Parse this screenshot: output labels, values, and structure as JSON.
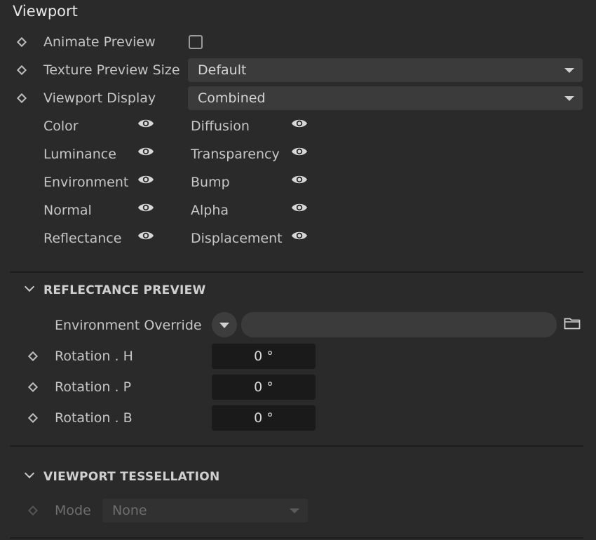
{
  "panel": {
    "title": "Viewport",
    "animate_preview": {
      "label": "Animate Preview",
      "checked": false
    },
    "texture_preview_size": {
      "label": "Texture Preview Size",
      "value": "Default"
    },
    "viewport_display": {
      "label": "Viewport Display",
      "value": "Combined"
    },
    "channels_left": [
      {
        "label": "Color",
        "icon": "eye-icon"
      },
      {
        "label": "Luminance",
        "icon": "eye-icon"
      },
      {
        "label": "Environment",
        "icon": "eye-icon"
      },
      {
        "label": "Normal",
        "icon": "eye-icon"
      },
      {
        "label": "Reflectance",
        "icon": "eye-icon"
      }
    ],
    "channels_right": [
      {
        "label": "Diffusion",
        "icon": "eye-icon"
      },
      {
        "label": "Transparency",
        "icon": "eye-icon"
      },
      {
        "label": "Bump",
        "icon": "eye-icon"
      },
      {
        "label": "Alpha",
        "icon": "eye-icon"
      },
      {
        "label": "Displacement",
        "icon": "eye-icon"
      }
    ]
  },
  "reflectance_preview": {
    "header": "REFLECTANCE PREVIEW",
    "environment_override": {
      "label": "Environment Override",
      "value": "",
      "icon": "folder-icon"
    },
    "rotation_h": {
      "label": "Rotation . H",
      "value": "0 °"
    },
    "rotation_p": {
      "label": "Rotation . P",
      "value": "0 °"
    },
    "rotation_b": {
      "label": "Rotation . B",
      "value": "0 °"
    }
  },
  "viewport_tessellation": {
    "header": "VIEWPORT TESSELLATION",
    "mode": {
      "label": "Mode",
      "value": "None",
      "enabled": false
    }
  },
  "colors": {
    "background": "#2a2a2a",
    "field": "#3b3b3b",
    "numeric_field": "#1a1a1a",
    "text": "#c6c6c6"
  }
}
